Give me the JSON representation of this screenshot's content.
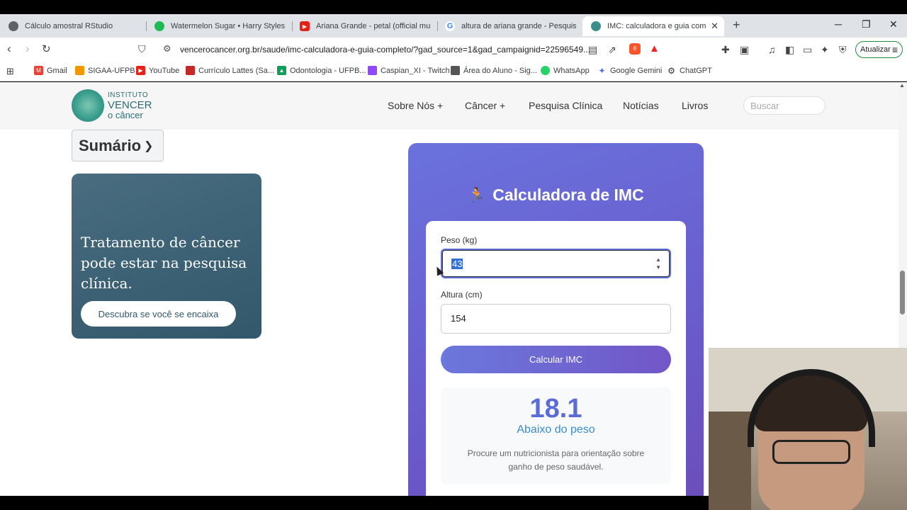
{
  "browser": {
    "tabs": [
      {
        "title": "Cálculo amostral RStudio",
        "favicon": "rstudio-icon",
        "color": "#5f6368"
      },
      {
        "title": "Watermelon Sugar • Harry Styles",
        "favicon": "spotify-icon",
        "color": "#1db954"
      },
      {
        "title": "Ariana Grande - petal (official music",
        "favicon": "youtube-icon",
        "color": "#e62117"
      },
      {
        "title": "altura de ariana grande - Pesquisa G",
        "favicon": "google-icon",
        "color": "#4285f4"
      },
      {
        "title": "IMC: calculadora e guia complet",
        "favicon": "vencer-icon",
        "color": "#3a8f8a",
        "active": true
      }
    ],
    "url": "vencerocancer.org.br/saude/imc-calculadora-e-guia-completo/?gad_source=1&gad_campaignid=22596549...",
    "update_label": "Atualizar",
    "brave_badge": "6",
    "alert_badge": "1",
    "bookmarks": [
      {
        "label": "Gmail",
        "icon": "gmail-icon",
        "color": "#ea4335"
      },
      {
        "label": "SIGAA-UFPB",
        "icon": "sigaa-icon",
        "color": "#f29900"
      },
      {
        "label": "YouTube",
        "icon": "youtube-icon",
        "color": "#e62117"
      },
      {
        "label": "Currículo Lattes (Sa...",
        "icon": "lattes-icon",
        "color": "#c62828"
      },
      {
        "label": "Odontologia - UFPB...",
        "icon": "drive-icon",
        "color": "#0f9d58"
      },
      {
        "label": "Caspian_XI - Twitch",
        "icon": "twitch-icon",
        "color": "#9146ff"
      },
      {
        "label": "Área do Aluno - Sig...",
        "icon": "student-icon",
        "color": "#555555"
      },
      {
        "label": "WhatsApp",
        "icon": "whatsapp-icon",
        "color": "#25d366"
      },
      {
        "label": "Google Gemini",
        "icon": "gemini-icon",
        "color": "#4a6cf7"
      },
      {
        "label": "ChatGPT",
        "icon": "chatgpt-icon",
        "color": "#333333"
      }
    ]
  },
  "site": {
    "logo": {
      "line1": "INSTITUTO",
      "line2": "VENCER",
      "line3": "o câncer"
    },
    "nav": [
      "Sobre Nós +",
      "Câncer +",
      "Pesquisa Clínica",
      "Notícias",
      "Livros"
    ],
    "search_placeholder": "Buscar",
    "summary_label": "Sumário",
    "promo": {
      "headline": "Tratamento de câncer pode estar na pesquisa clínica.",
      "cta": "Descubra se você se encaixa"
    },
    "calculator": {
      "title": "Calculadora de IMC",
      "weight_label": "Peso (kg)",
      "weight_value": "43",
      "height_label": "Altura (cm)",
      "height_value": "154",
      "button": "Calcular IMC",
      "result_value": "18.1",
      "result_category": "Abaixo do peso",
      "result_advice": "Procure um nutricionista para orientação sobre ganho de peso saudável."
    }
  },
  "colors": {
    "accent": "#6a5fcf",
    "result": "#5b6bd8",
    "category": "#3a8ed0",
    "brand": "#2a6f74"
  }
}
